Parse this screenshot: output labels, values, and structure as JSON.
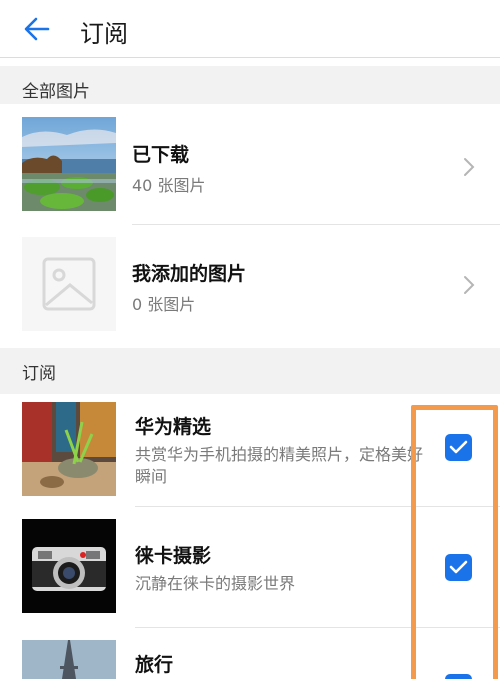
{
  "header": {
    "title": "订阅",
    "back_icon": "arrow-left-icon"
  },
  "sections": {
    "all_pictures": "全部图片",
    "subscriptions": "订阅"
  },
  "albums": [
    {
      "title": "已下载",
      "count": "40 张图片"
    },
    {
      "title": "我添加的图片",
      "count": "0 张图片"
    }
  ],
  "subscriptions": [
    {
      "title": "华为精选",
      "desc": "共赏华为手机拍摄的精美照片，定格美好瞬间",
      "checked": true
    },
    {
      "title": "徕卡摄影",
      "desc": "沉静在徕卡的摄影世界",
      "checked": true
    },
    {
      "title": "旅行",
      "desc": "",
      "checked": true
    }
  ],
  "colors": {
    "accent": "#1a73e8",
    "highlight": "#f39a4c",
    "section_bg": "#f2f2f2"
  }
}
